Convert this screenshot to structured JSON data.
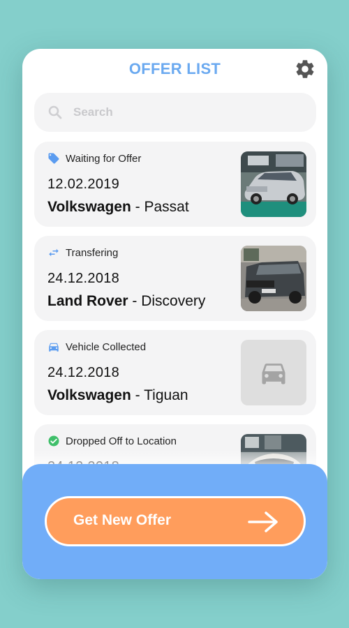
{
  "header": {
    "title": "OFFER LIST"
  },
  "search": {
    "placeholder": "Search"
  },
  "offers": [
    {
      "status": "Waiting for Offer",
      "status_icon": "tag-icon",
      "date": "12.02.2019",
      "make": "Volkswagen",
      "model": "Passat",
      "image": "silver-sedan-photo"
    },
    {
      "status": "Transfering",
      "status_icon": "transfer-arrows-icon",
      "date": "24.12.2018",
      "make": "Land Rover",
      "model": "Discovery",
      "image": "grey-suv-photo"
    },
    {
      "status": "Vehicle Collected",
      "status_icon": "car-icon",
      "date": "24.12.2018",
      "make": "Volkswagen",
      "model": "Tiguan",
      "image": "car-placeholder-icon"
    },
    {
      "status": "Dropped Off to Location",
      "status_icon": "check-circle-icon",
      "date": "24.12.2018",
      "make": "",
      "model": "",
      "image": "white-car-photo"
    }
  ],
  "cta": {
    "label": "Get New Offer",
    "icon": "arrow-right-icon"
  },
  "colors": {
    "background": "#84cfcb",
    "accent_blue": "#6aa9f0",
    "panel_blue": "#71adf8",
    "cta_orange": "#ff9d5c",
    "status_icon_blue": "#5b9cf0",
    "check_green": "#3fbf6a"
  }
}
